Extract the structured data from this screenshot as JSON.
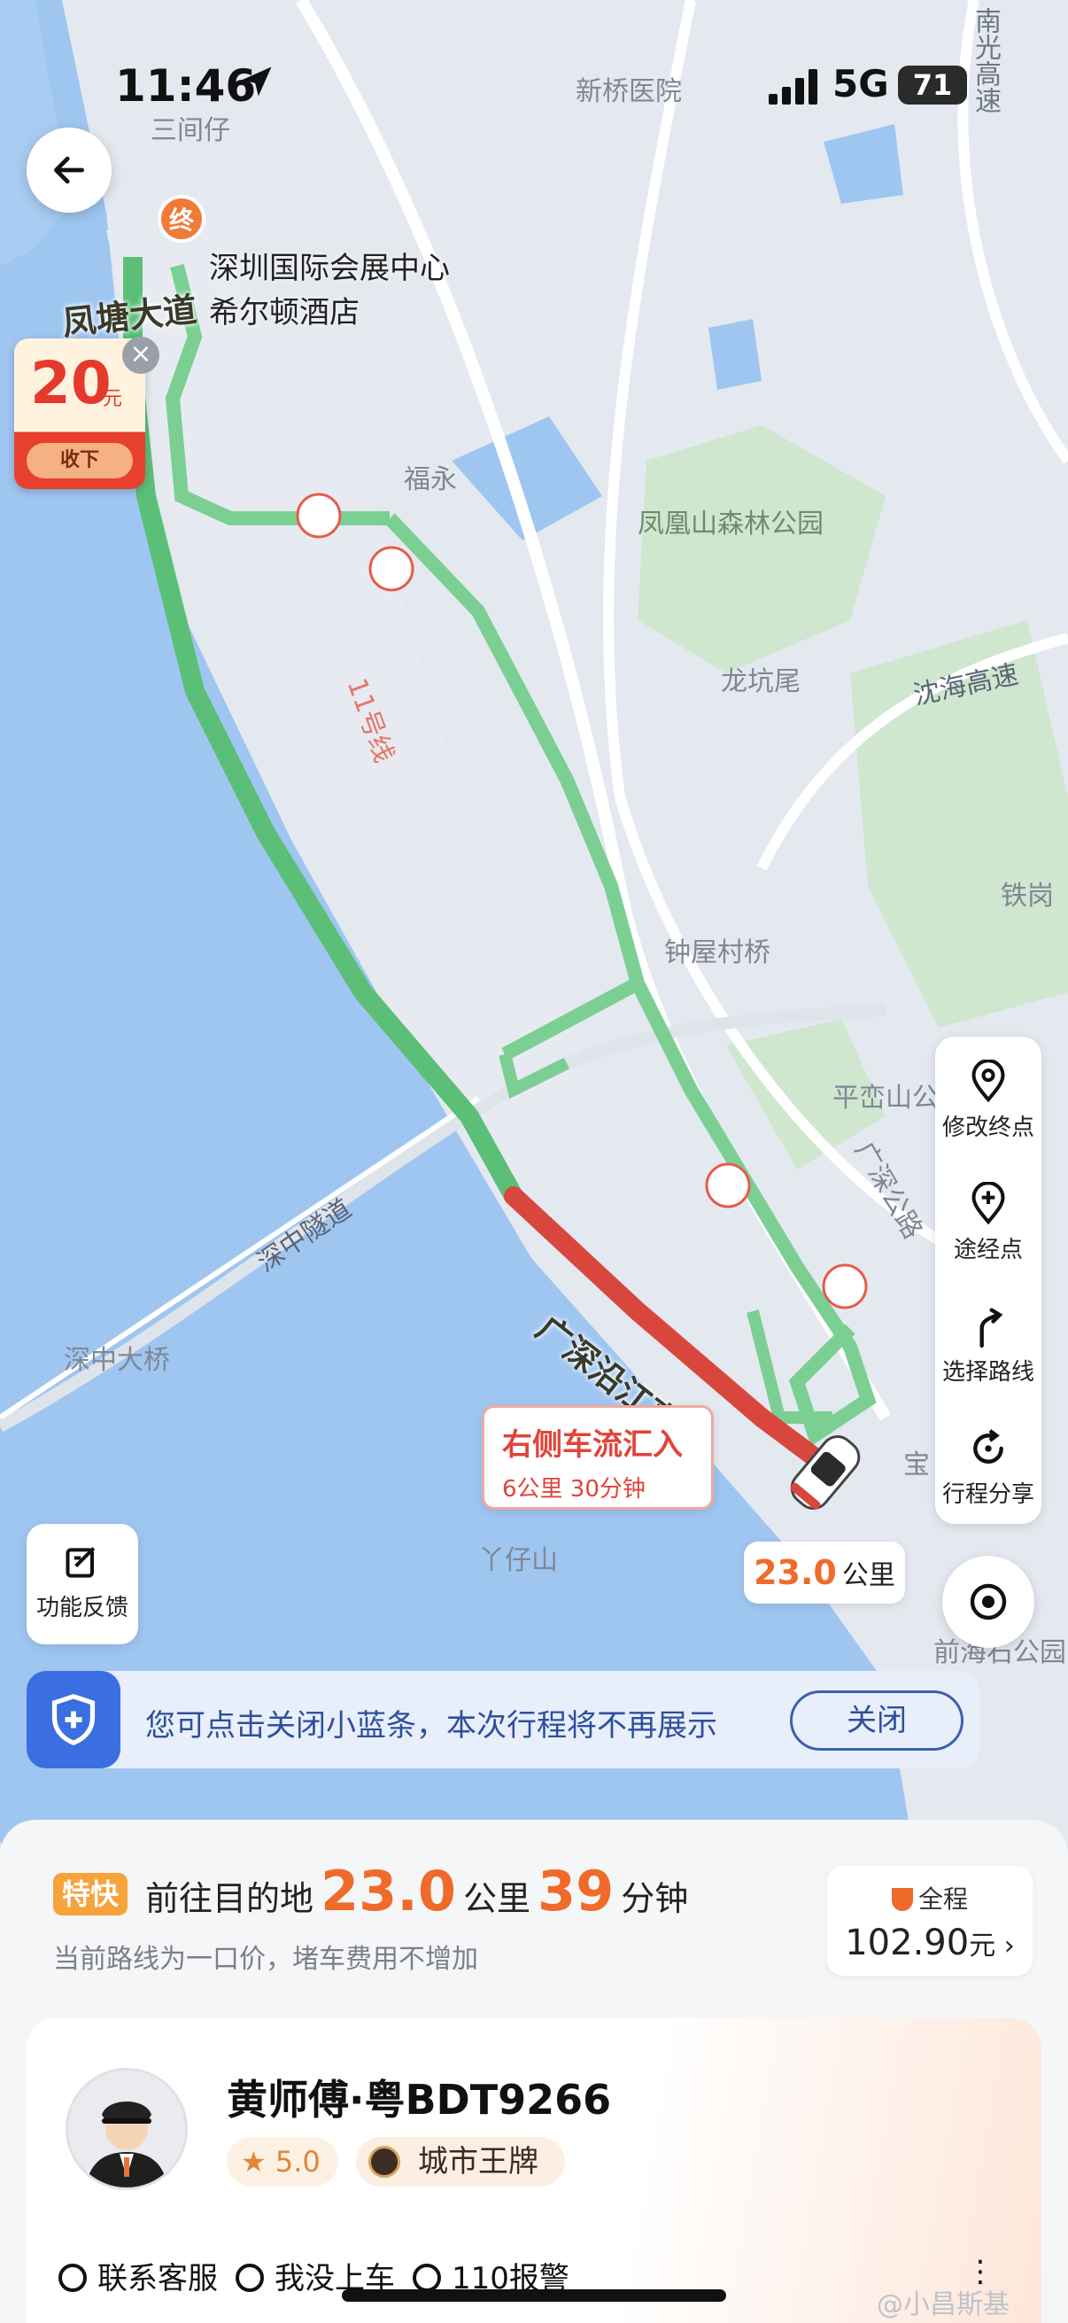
{
  "status": {
    "time": "11:46",
    "network": "5G",
    "battery": "71"
  },
  "map": {
    "labels": {
      "sanjianci": "三间仔",
      "xinqiao_hospital": "新桥医院",
      "nanguang": "南光高速",
      "fuyong": "福永",
      "fenghuang_park": "凤凰山森林公园",
      "longkengwei": "龙坑尾",
      "yanhai": "沈海高速",
      "tiegang": "铁岗",
      "line11": "11号线",
      "zhongwu": "钟屋村桥",
      "pingluan": "平峦山公",
      "guangshen_road": "广深公路",
      "shenzhong_tunnel": "深中隧道",
      "shenzhong_bridge": "深中大桥",
      "yazai": "丫仔山",
      "qianhai": "前海石公园",
      "bao": "宝",
      "road_fengtang": "凤塘大道",
      "road_yanjiang": "广深沿江高速"
    },
    "destination": {
      "pin": "终",
      "line1": "深圳国际会展中心",
      "line2": "希尔顿酒店"
    },
    "coupon": {
      "amount": "20",
      "unit": "元",
      "button": "收下",
      "close": "×"
    },
    "traffic": {
      "title": "右侧车流汇入",
      "detail": "6公里 30分钟"
    },
    "remaining": {
      "value": "23.0",
      "unit": "公里"
    }
  },
  "side_panel": {
    "change_dest": "修改终点",
    "waypoint": "途经点",
    "choose_route": "选择路线",
    "share_trip": "行程分享"
  },
  "feedback": {
    "label": "功能反馈"
  },
  "bluebar": {
    "text": "您可点击关闭小蓝条，本次行程将不再展示",
    "close": "关闭"
  },
  "trip": {
    "tag": "特快",
    "prefix": "前往目的地",
    "distance": "23.0",
    "distance_unit": "公里",
    "minutes": "39",
    "minutes_unit": "分钟",
    "note": "当前路线为一口价，堵车费用不增加",
    "fare_label": "全程",
    "fare_value": "102.90",
    "fare_unit": "元 ›"
  },
  "driver": {
    "name": "黄师傅·粤BDT9266",
    "rating": "5.0",
    "badge": "城市王牌",
    "actions": {
      "support": "联系客服",
      "not_boarded": "我没上车",
      "police": "110报警",
      "more": "⋮"
    }
  },
  "watermark": "@小昌斯基",
  "colors": {
    "route_green": "#5cbf78",
    "route_red": "#d9463e",
    "accent": "#f06a2b",
    "blue": "#3b6ee0"
  }
}
